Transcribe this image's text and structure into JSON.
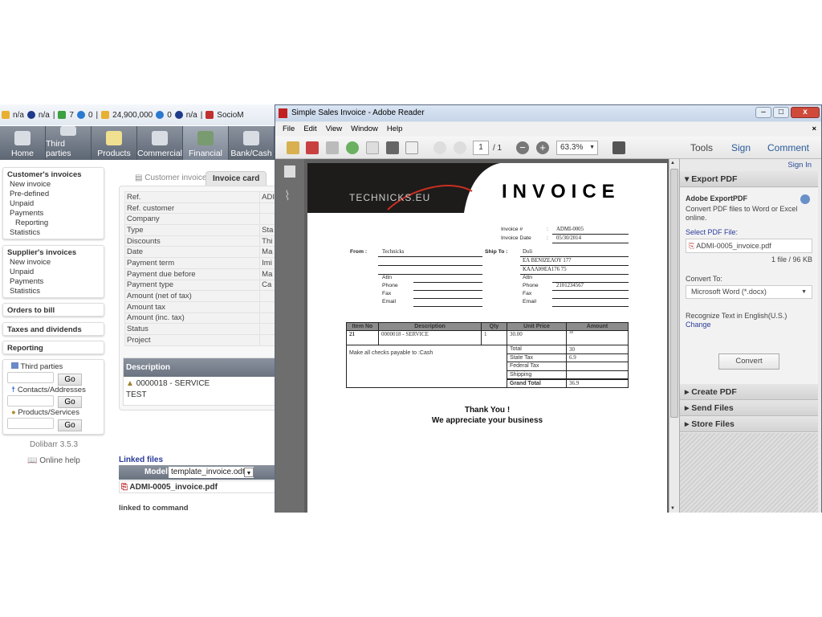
{
  "statusbar": [
    "n/a",
    "n/a",
    "7",
    "0",
    "24,900,000",
    "0",
    "n/a",
    "SocioM"
  ],
  "nav": [
    {
      "label": "Home"
    },
    {
      "label": "Third parties"
    },
    {
      "label": "Products"
    },
    {
      "label": "Commercial"
    },
    {
      "label": "Financial",
      "active": true
    },
    {
      "label": "Bank/Cash"
    }
  ],
  "sidebar": {
    "customer": {
      "title": "Customer's invoices",
      "items": [
        "New invoice",
        "Pre-defined",
        "Unpaid",
        "Payments",
        "Reporting",
        "Statistics"
      ]
    },
    "supplier": {
      "title": "Supplier's invoices",
      "items": [
        "New invoice",
        "Unpaid",
        "Payments",
        "Statistics"
      ]
    },
    "orders": "Orders to bill",
    "taxes": "Taxes and dividends",
    "reporting": "Reporting",
    "search": {
      "third": "Third parties",
      "contacts": "Contacts/Addresses",
      "products": "Products/Services",
      "go": "Go"
    },
    "version": "Dolibarr 3.5.3",
    "help": "Online help"
  },
  "tabs": {
    "customer_invoice": "Customer invoice",
    "invoice_card": "Invoice card"
  },
  "card": {
    "rows": [
      [
        "Ref.",
        "ADI"
      ],
      [
        "Ref. customer",
        ""
      ],
      [
        "Company",
        ""
      ],
      [
        "Type",
        "Sta"
      ],
      [
        "Discounts",
        "Thi"
      ],
      [
        "Date",
        "Ma"
      ],
      [
        "Payment term",
        "Imi"
      ],
      [
        "Payment due before",
        "Ma"
      ],
      [
        "Payment type",
        "Ca"
      ],
      [
        "Amount (net of tax)",
        ""
      ],
      [
        "Amount tax",
        ""
      ],
      [
        "Amount (inc. tax)",
        ""
      ],
      [
        "Status",
        ""
      ],
      [
        "Project",
        ""
      ]
    ],
    "desc_header": "Description",
    "desc_line": "0000018 - SERVICE",
    "desc_note": "TEST"
  },
  "linked": {
    "title": "Linked files",
    "model_label": "Model",
    "model_value": "template_invoice.odt",
    "file": "ADMI-0005_invoice.pdf",
    "linked_command": "linked to command"
  },
  "adobe": {
    "title": "Simple Sales Invoice - Adobe Reader",
    "menu": [
      "File",
      "Edit",
      "View",
      "Window",
      "Help"
    ],
    "page": "1",
    "page_total": "/ 1",
    "zoom": "63.3%",
    "tools": "Tools",
    "sign": "Sign",
    "comment": "Comment"
  },
  "panel": {
    "sign_in": "Sign In",
    "export": "Export PDF",
    "adobe_export": "Adobe ExportPDF",
    "export_desc": "Convert PDF files to Word or Excel online.",
    "select": "Select PDF File:",
    "file": "ADMI-0005_invoice.pdf",
    "file_info": "1 file / 96 KB",
    "convert_to": "Convert To:",
    "format": "Microsoft Word (*.docx)",
    "recognize": "Recognize Text in English(U.S.)",
    "change": "Change",
    "convert": "Convert",
    "create": "Create PDF",
    "send": "Send Files",
    "store": "Store Files"
  },
  "invoice": {
    "logo": "TECHNICKS.EU",
    "title": "INVOICE",
    "num_label": "Invoice #",
    "num": "ADMI-0005",
    "date_label": "Invoice Date",
    "date": "05/30/2014",
    "from_label": "From :",
    "from": "Technicks",
    "ship_label": "Ship To :",
    "ship": [
      "Doli",
      "ΕΛ ΒΕΝΙΖΕΛΟΥ 177",
      "ΚΑΛΛΙΘΕΑ176 75"
    ],
    "attn": "Attn",
    "phone": "Phone",
    "fax": "Fax",
    "email": "Email",
    "ship_phone": "2101234567",
    "headers": [
      "Item No",
      "Description",
      "Qty",
      "Unit Price",
      "Amount"
    ],
    "item": [
      "21",
      "0000018 - SERVICE",
      "1",
      "30.00",
      "30"
    ],
    "checks": "Make all checks payable to :Cash",
    "totals": [
      [
        "Total",
        "30"
      ],
      [
        "State Tax",
        "6.9"
      ],
      [
        "Federal Tax",
        ""
      ],
      [
        "Shipping",
        ""
      ],
      [
        "Grand Total",
        "36.9"
      ]
    ],
    "thanks": "Thank You !",
    "appreciate": "We appreciate your business"
  },
  "colors": {
    "nav": "#6a7380",
    "link": "#2a3a9a",
    "invoice_header": "#1e1b1b"
  }
}
